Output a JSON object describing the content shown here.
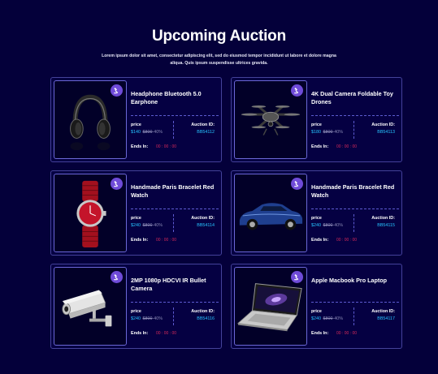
{
  "header": {
    "title": "Upcoming Auction",
    "subtitle": "Lorem ipsum dolor sit amet, consectetur adipiscing elit, sed do eiusmod tempor incididunt ut labore et dolore magna aliqua. Quis ipsum suspendisse ultrices gravida."
  },
  "labels": {
    "price": "price",
    "auction_id": "Auction ID:",
    "ends_in": "Ends In:"
  },
  "colors": {
    "background": "#04003a",
    "accent_price": "#26c4ff",
    "timer": "#d4285a",
    "badge": "#6f4bd8"
  },
  "products": [
    {
      "name": "Headphone Bluetooth 5.0 Earphone",
      "price": "$140",
      "old_price": "$800",
      "discount": "-40%",
      "auction_id": "BB54112",
      "timer": "00 : 00 : 00",
      "image": "headphone-image",
      "badge_icon": "gavel-icon"
    },
    {
      "name": "4K Dual Camera Foldable Toy Drones",
      "price": "$180",
      "old_price": "$800",
      "discount": "-40%",
      "auction_id": "BB54113",
      "timer": "00 : 00 : 00",
      "image": "drone-image",
      "badge_icon": "gavel-icon"
    },
    {
      "name": "Handmade Paris Bracelet Red Watch",
      "price": "$240",
      "old_price": "$800",
      "discount": "-40%",
      "auction_id": "BB54114",
      "timer": "00 : 00 : 00",
      "image": "watch-image",
      "badge_icon": "gavel-icon"
    },
    {
      "name": "Handmade Paris Bracelet Red Watch",
      "price": "$240",
      "old_price": "$800",
      "discount": "-40%",
      "auction_id": "BB54115",
      "timer": "00 : 00 : 00",
      "image": "car-image",
      "badge_icon": "gavel-icon"
    },
    {
      "name": "2MP 1080p HDCVI IR Bullet Camera",
      "price": "$240",
      "old_price": "$800",
      "discount": "-40%",
      "auction_id": "BB54116",
      "timer": "00 : 00 : 00",
      "image": "camera-image",
      "badge_icon": "gavel-icon"
    },
    {
      "name": "Apple Macbook Pro Laptop",
      "price": "$240",
      "old_price": "$800",
      "discount": "-40%",
      "auction_id": "BB54117",
      "timer": "00 : 00 : 00",
      "image": "laptop-image",
      "badge_icon": "gavel-icon"
    }
  ]
}
